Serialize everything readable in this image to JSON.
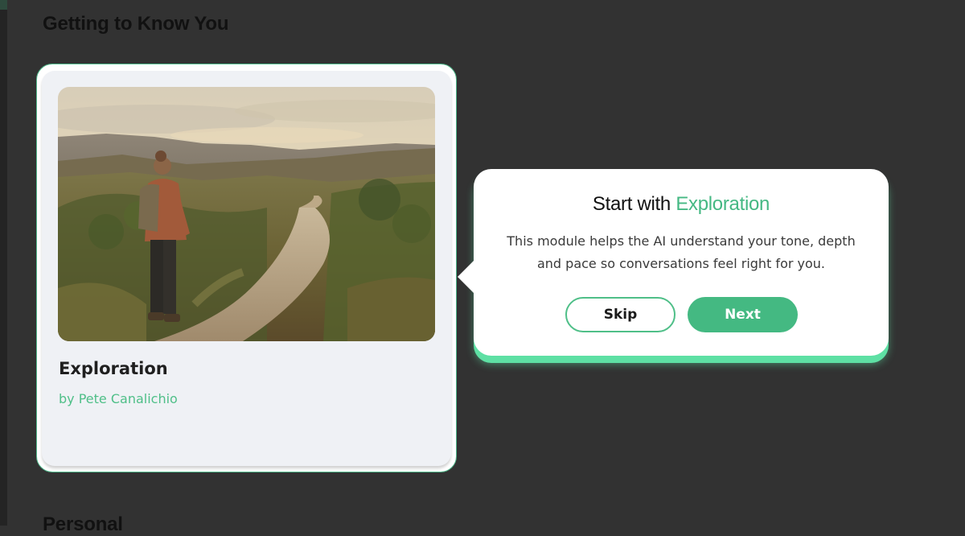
{
  "page": {
    "section_title": "Getting to Know You",
    "next_section_title": "Personal"
  },
  "card": {
    "title": "Exploration",
    "author": "by Pete Canalichio",
    "image": "woman-with-backpack-on-country-path"
  },
  "tooltip": {
    "heading_prefix": "Start with ",
    "heading_accent": "Exploration",
    "body": "This module helps the AI understand your tone, depth and pace so conversations feel right for you.",
    "skip_label": "Skip",
    "next_label": "Next"
  },
  "colors": {
    "background": "#323232",
    "accent": "#45b883",
    "glow": "#5ee0a4",
    "card": "#eff1f5"
  }
}
